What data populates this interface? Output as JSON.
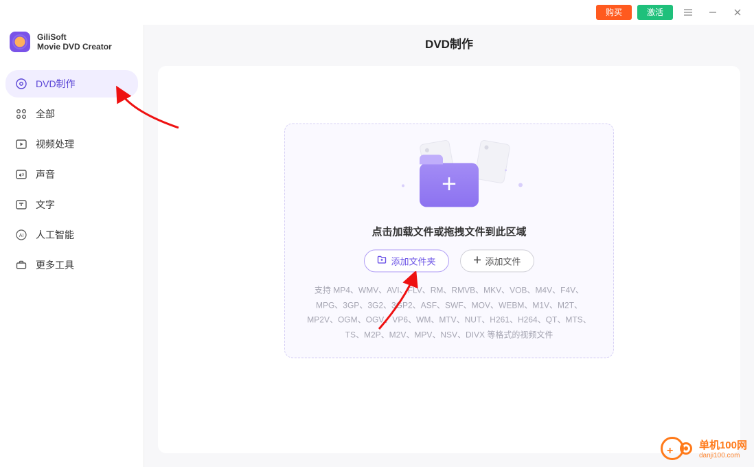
{
  "titlebar": {
    "buy_label": "购买",
    "activate_label": "激活"
  },
  "brand": {
    "line1": "GiliSoft",
    "line2": "Movie DVD Creator"
  },
  "sidebar": {
    "items": [
      {
        "label": "DVD制作",
        "icon": "dvd-disc-icon",
        "active": true
      },
      {
        "label": "全部",
        "icon": "grid-icon",
        "active": false
      },
      {
        "label": "视频处理",
        "icon": "play-box-icon",
        "active": false
      },
      {
        "label": "声音",
        "icon": "audio-icon",
        "active": false
      },
      {
        "label": "文字",
        "icon": "text-icon",
        "active": false
      },
      {
        "label": "人工智能",
        "icon": "ai-icon",
        "active": false
      },
      {
        "label": "更多工具",
        "icon": "toolbox-icon",
        "active": false
      }
    ]
  },
  "page": {
    "title": "DVD制作"
  },
  "drop": {
    "title": "点击加载文件或拖拽文件到此区域",
    "add_folder_label": "添加文件夹",
    "add_file_label": "添加文件",
    "formats": "支持 MP4、WMV、AVI、FLV、RM、RMVB、MKV、VOB、M4V、F4V、MPG、3GP、3G2、3GP2、ASF、SWF、MOV、WEBM、M1V、M2T、MP2V、OGM、OGV、VP6、WM、MTV、NUT、H261、H264、QT、MTS、TS、M2P、M2V、MPV、NSV、DIVX 等格式的视频文件"
  },
  "watermark": {
    "title": "单机100网",
    "url": "danji100.com"
  }
}
